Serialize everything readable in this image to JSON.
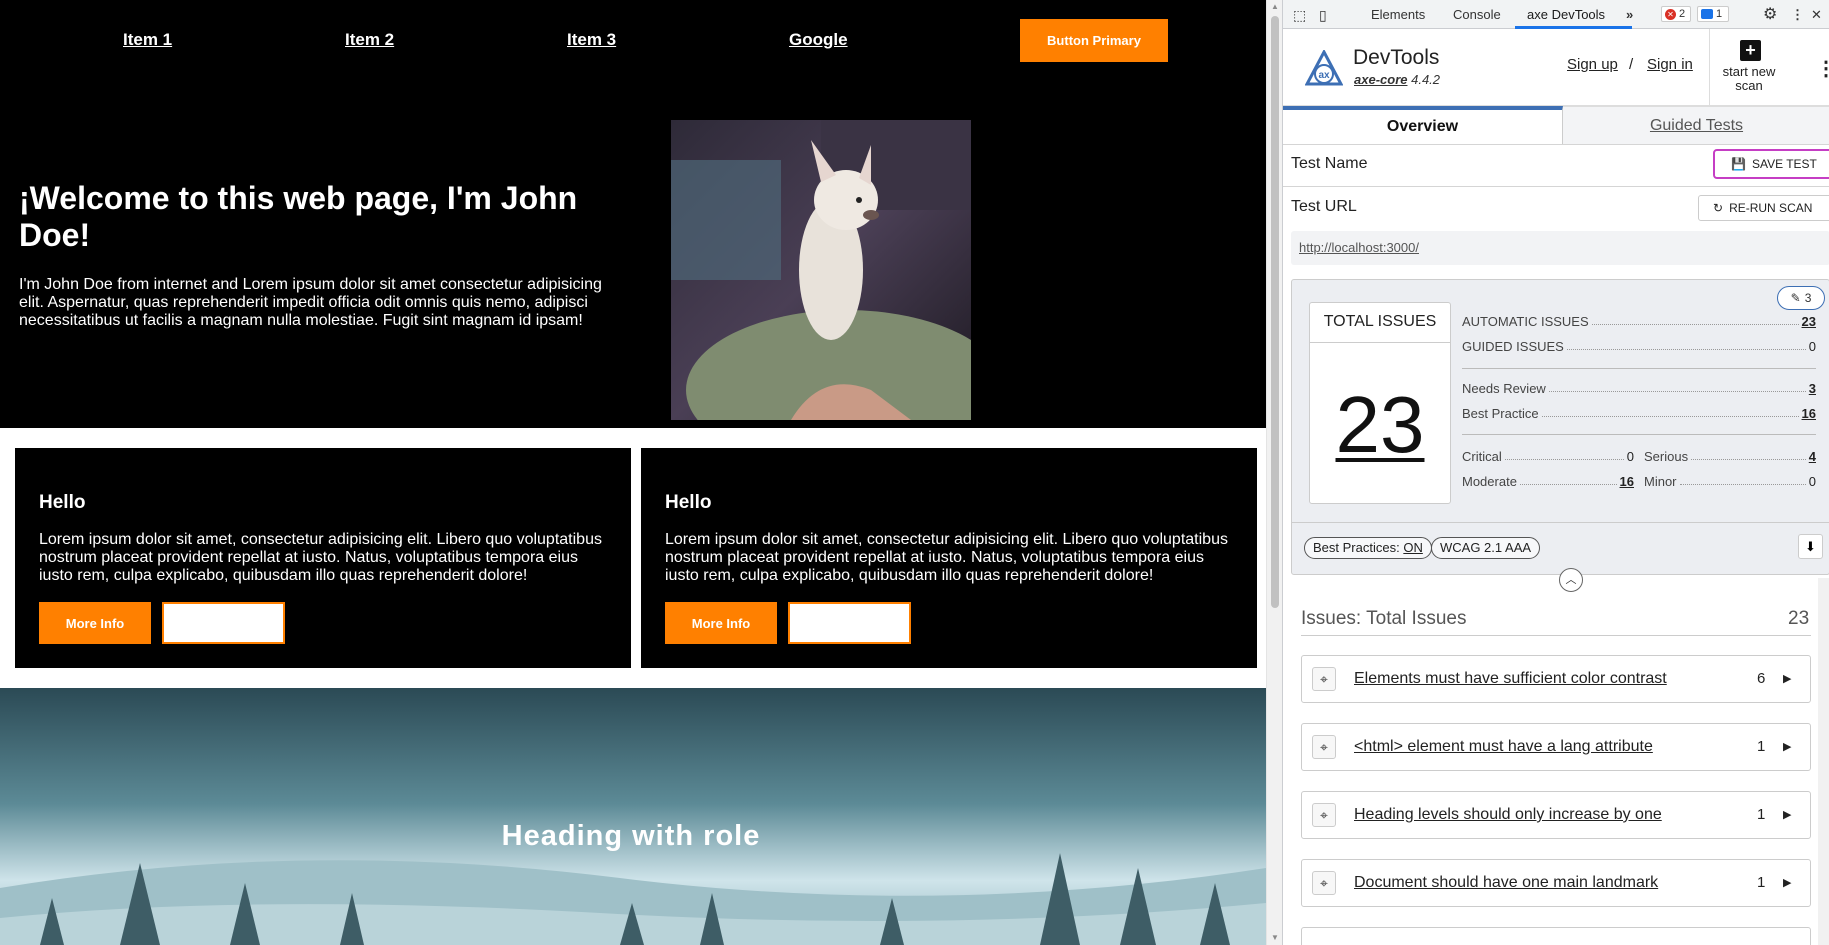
{
  "page": {
    "nav": [
      "Item 1",
      "Item 2",
      "Item 3",
      "Google"
    ],
    "primary_button": "Button Primary",
    "hero_title": "¡Welcome to this web page, I'm John Doe!",
    "hero_text": "I'm John Doe from internet and Lorem ipsum dolor sit amet consectetur adipisicing elit. Aspernatur, quas reprehenderit impedit officia odit omnis quis nemo, adipisci necessitatibus ut facilis a magnam nulla molestiae. Fugit sint magnam id ipsam!",
    "cards": [
      {
        "title": "Hello",
        "text": "Lorem ipsum dolor sit amet, consectetur adipisicing elit. Libero quo voluptatibus nostrum placeat provident repellat at iusto. Natus, voluptatibus tempora eius iusto rem, culpa explicabo, quibusdam illo quas reprehenderit dolore!",
        "button": "More Info"
      },
      {
        "title": "Hello",
        "text": "Lorem ipsum dolor sit amet, consectetur adipisicing elit. Libero quo voluptatibus nostrum placeat provident repellat at iusto. Natus, voluptatibus tempora eius iusto rem, culpa explicabo, quibusdam illo quas reprehenderit dolore!",
        "button": "More Info"
      }
    ],
    "banner_heading": "Heading with role",
    "accent": "#ff8000"
  },
  "devtools": {
    "tabs": [
      "Elements",
      "Console",
      "axe DevTools"
    ],
    "active_tab": "axe DevTools",
    "error_count": "2",
    "message_count": "1",
    "header": {
      "title": "DevTools",
      "engine": "axe-core",
      "version": "4.4.2",
      "sign_up": "Sign up",
      "separator": "/",
      "sign_in": "Sign in",
      "new_scan": "start new scan"
    },
    "view_tabs": [
      "Overview",
      "Guided Tests"
    ],
    "test_name_label": "Test Name",
    "save_test": "SAVE TEST",
    "test_url_label": "Test URL",
    "rerun": "RE-RUN SCAN",
    "url": "http://localhost:3000/",
    "edit_count": "3",
    "total_label": "TOTAL ISSUES",
    "total": "23",
    "stats": {
      "automatic_label": "AUTOMATIC ISSUES",
      "automatic": "23",
      "guided_label": "GUIDED ISSUES",
      "guided": "0",
      "review_label": "Needs Review",
      "review": "3",
      "best_label": "Best Practice",
      "best": "16",
      "critical_label": "Critical",
      "critical": "0",
      "serious_label": "Serious",
      "serious": "4",
      "moderate_label": "Moderate",
      "moderate": "16",
      "minor_label": "Minor",
      "minor": "0"
    },
    "best_practices_chip": "Best Practices:",
    "best_practices_state": "ON",
    "wcag_chip": "WCAG 2.1 AAA",
    "issues_heading": "Issues: Total Issues",
    "issues_total": "23",
    "issues": [
      {
        "label": "Elements must have sufficient color contrast",
        "count": "6"
      },
      {
        "label": "<html> element must have a lang attribute",
        "count": "1"
      },
      {
        "label": "Heading levels should only increase by one",
        "count": "1"
      },
      {
        "label": "Document should have one main landmark",
        "count": "1"
      }
    ]
  }
}
